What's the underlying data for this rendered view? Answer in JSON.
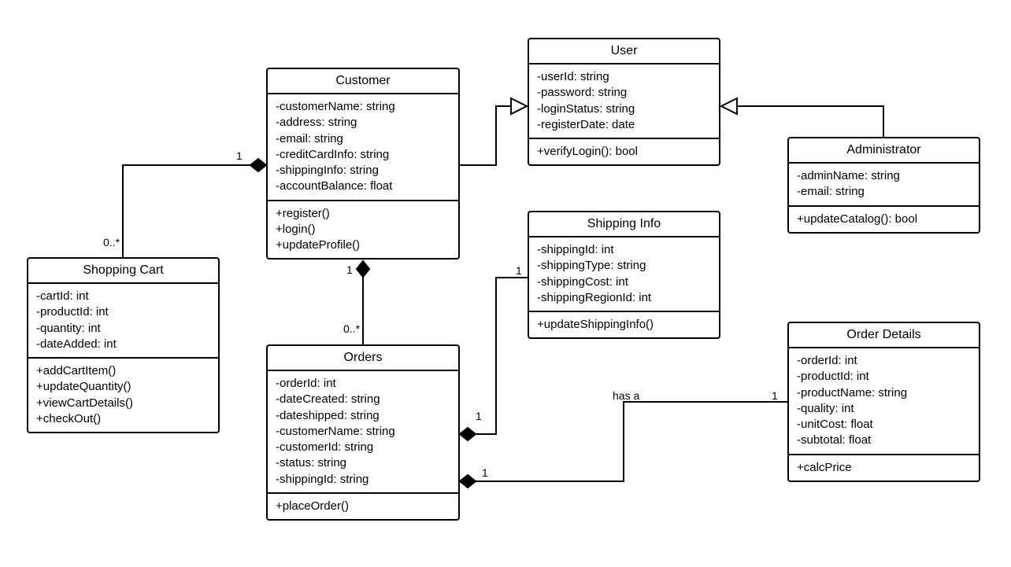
{
  "classes": {
    "user": {
      "title": "User",
      "attrs": [
        "-userId: string",
        "-password: string",
        "-loginStatus: string",
        "-registerDate: date"
      ],
      "ops": [
        "+verifyLogin(): bool"
      ]
    },
    "customer": {
      "title": "Customer",
      "attrs": [
        "-customerName: string",
        "-address: string",
        "-email: string",
        "-creditCardInfo: string",
        "-shippingInfo: string",
        "-accountBalance: float"
      ],
      "ops": [
        "+register()",
        "+login()",
        "+updateProfile()"
      ]
    },
    "administrator": {
      "title": "Administrator",
      "attrs": [
        "-adminName: string",
        "-email: string"
      ],
      "ops": [
        "+updateCatalog(): bool"
      ]
    },
    "shoppingCart": {
      "title": "Shopping Cart",
      "attrs": [
        "-cartId: int",
        "-productId: int",
        "-quantity: int",
        "-dateAdded: int"
      ],
      "ops": [
        "+addCartItem()",
        "+updateQuantity()",
        "+viewCartDetails()",
        "+checkOut()"
      ]
    },
    "orders": {
      "title": "Orders",
      "attrs": [
        "-orderId: int",
        "-dateCreated: string",
        "-dateshipped: string",
        "-customerName: string",
        "-customerId: string",
        "-status: string",
        "-shippingId: string"
      ],
      "ops": [
        "+placeOrder()"
      ]
    },
    "shippingInfo": {
      "title": "Shipping Info",
      "attrs": [
        "-shippingId: int",
        "-shippingType: string",
        "-shippingCost: int",
        "-shippingRegionId: int"
      ],
      "ops": [
        "+updateShippingInfo()"
      ]
    },
    "orderDetails": {
      "title": "Order Details",
      "attrs": [
        "-orderId: int",
        "-productId: int",
        "-productName: string",
        "-quality: int",
        "-unitCost: float",
        "-subtotal: float"
      ],
      "ops": [
        "+calcPrice"
      ]
    }
  },
  "labels": {
    "custCart1": "1",
    "custCartMany": "0..*",
    "custOrders1": "1",
    "custOrdersMany": "0..*",
    "ordersShipping_orders": "1",
    "ordersShipping_shipping": "1",
    "ordersDetails_orders": "1",
    "ordersDetails_details": "1",
    "hasA": "has a"
  },
  "relationships": [
    {
      "from": "Customer",
      "to": "User",
      "type": "generalization"
    },
    {
      "from": "Administrator",
      "to": "User",
      "type": "generalization"
    },
    {
      "from": "Customer",
      "to": "Shopping Cart",
      "type": "composition",
      "mult_from": "1",
      "mult_to": "0..*"
    },
    {
      "from": "Customer",
      "to": "Orders",
      "type": "composition",
      "mult_from": "1",
      "mult_to": "0..*"
    },
    {
      "from": "Orders",
      "to": "Shipping Info",
      "type": "composition",
      "mult_from": "1",
      "mult_to": "1"
    },
    {
      "from": "Orders",
      "to": "Order Details",
      "type": "composition",
      "label": "has a",
      "mult_from": "1",
      "mult_to": "1"
    }
  ]
}
